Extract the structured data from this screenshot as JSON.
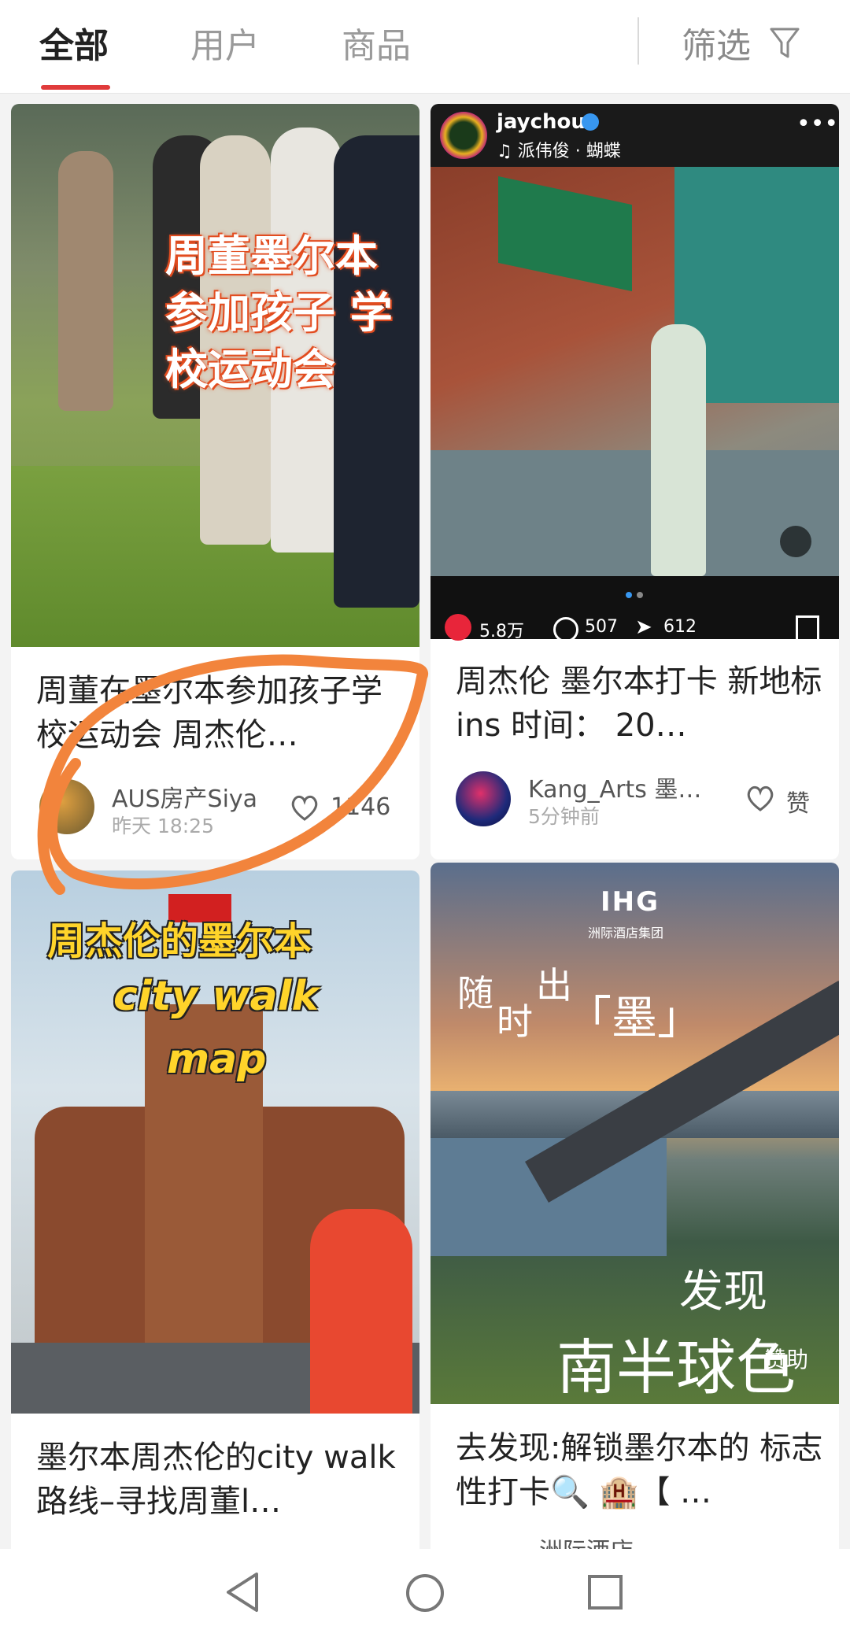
{
  "tabs": {
    "all": "全部",
    "users": "用户",
    "products": "商品"
  },
  "filter": {
    "label": "筛选"
  },
  "cards": [
    {
      "cover_text": "周董墨尔本 参加孩子 学校运动会",
      "title": "周董在墨尔本参加孩子学校运动会 周杰伦…",
      "author": "AUS房产Siya",
      "time": "昨天 18:25",
      "likes": "1146"
    },
    {
      "post_user": "jaychou",
      "post_music": "♫ 派伟俊 · 蝴蝶",
      "post_likes": "5.8万",
      "post_comments": "507",
      "post_shares": "612",
      "title": "周杰伦 墨尔本打卡 新地标 ins 时间： 20…",
      "author": "Kang_Arts 墨…",
      "time": "5分钟前",
      "likes": "赞"
    },
    {
      "cover_text_1": "周杰伦的墨尔本",
      "cover_text_2": "city walk",
      "cover_text_3": "map",
      "title": "墨尔本周杰伦的city walk路线–寻找周董l…"
    },
    {
      "brand": "IHG",
      "brand_sub": "洲际酒店集团",
      "slogan_1": "随",
      "slogan_2": "时",
      "slogan_3": "出",
      "slogan_4": "「墨」",
      "slogan_5": "发现",
      "slogan_6": "南半球色彩",
      "sponsor": "赞助",
      "title": "去发现:解锁墨尔本的 标志性打卡🔍 🏨【 …",
      "author": "洲际酒店"
    }
  ],
  "colors": {
    "accent": "#e03b3b",
    "annotation": "#f2843c"
  }
}
